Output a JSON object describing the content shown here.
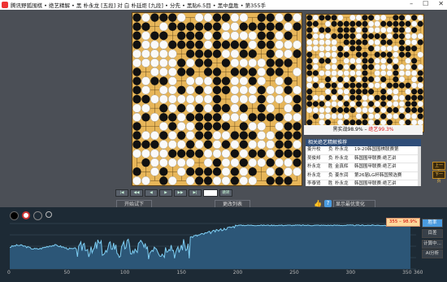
{
  "window": {
    "title": "腾讯野狐围棋 • 绝艺精解 • 黑 朴永龙 [五段] 对 白 朴廷炬 [九段] • 分先 • 黑贴6.5目 • 黑中盘胜 • 第355手",
    "minimize": "–",
    "maximize": "☐",
    "close": "✕"
  },
  "status": {
    "prefix": "黑实战",
    "black_rate": "98.9%",
    "sep": "–",
    "win_prefix": "绝艺",
    "win_rate": "99.3%"
  },
  "related": {
    "header": "相关绝艺精解推荐",
    "rows": [
      {
        "player1": "姜升校",
        "color": "负",
        "player2": "朴永龙",
        "event": "19-20韩国围棋联赛第"
      },
      {
        "player1": "吴俊邦",
        "color": "负",
        "player2": "朴永龙",
        "event": "韩国围甲联赛:绝艺讲"
      },
      {
        "player1": "朴永龙",
        "color": "胜",
        "player2": "金真辉",
        "event": "韩国围甲联赛:绝艺讲"
      },
      {
        "player1": "朴永龙",
        "color": "负",
        "player2": "姜东润",
        "event": "第26届LG杯韩国预选赛"
      },
      {
        "player1": "李泰贤",
        "color": "胜",
        "player2": "朴永龙",
        "event": "韩国围甲联赛:绝艺讲"
      }
    ]
  },
  "controls": {
    "labels": [
      "|◀",
      "◀◀",
      "◀",
      "▶",
      "▶▶",
      "▶|"
    ],
    "move_field": "",
    "jump": "跳转"
  },
  "actions": {
    "start_test": "开始试下",
    "hide_lines": "更改列表",
    "best_change": "显示最优变化"
  },
  "side": {
    "prev": "上一页",
    "next": "下一页"
  },
  "graph": {
    "tooltip": "355 – 98.9%",
    "x_ticks": [
      "0",
      "50",
      "100",
      "150",
      "200",
      "250",
      "300",
      "350",
      "360"
    ],
    "btn_winrate": "胜率",
    "btn_points": "目差",
    "btn_calc": "计算中...",
    "btn_ai": "AI分析",
    "colors": {
      "line": "#7ecff5",
      "fill": "#2c5677",
      "bg": "#1d2a35"
    }
  },
  "colors": {
    "board": "#e7b659",
    "black": "#111111",
    "white": "#fafafa"
  }
}
